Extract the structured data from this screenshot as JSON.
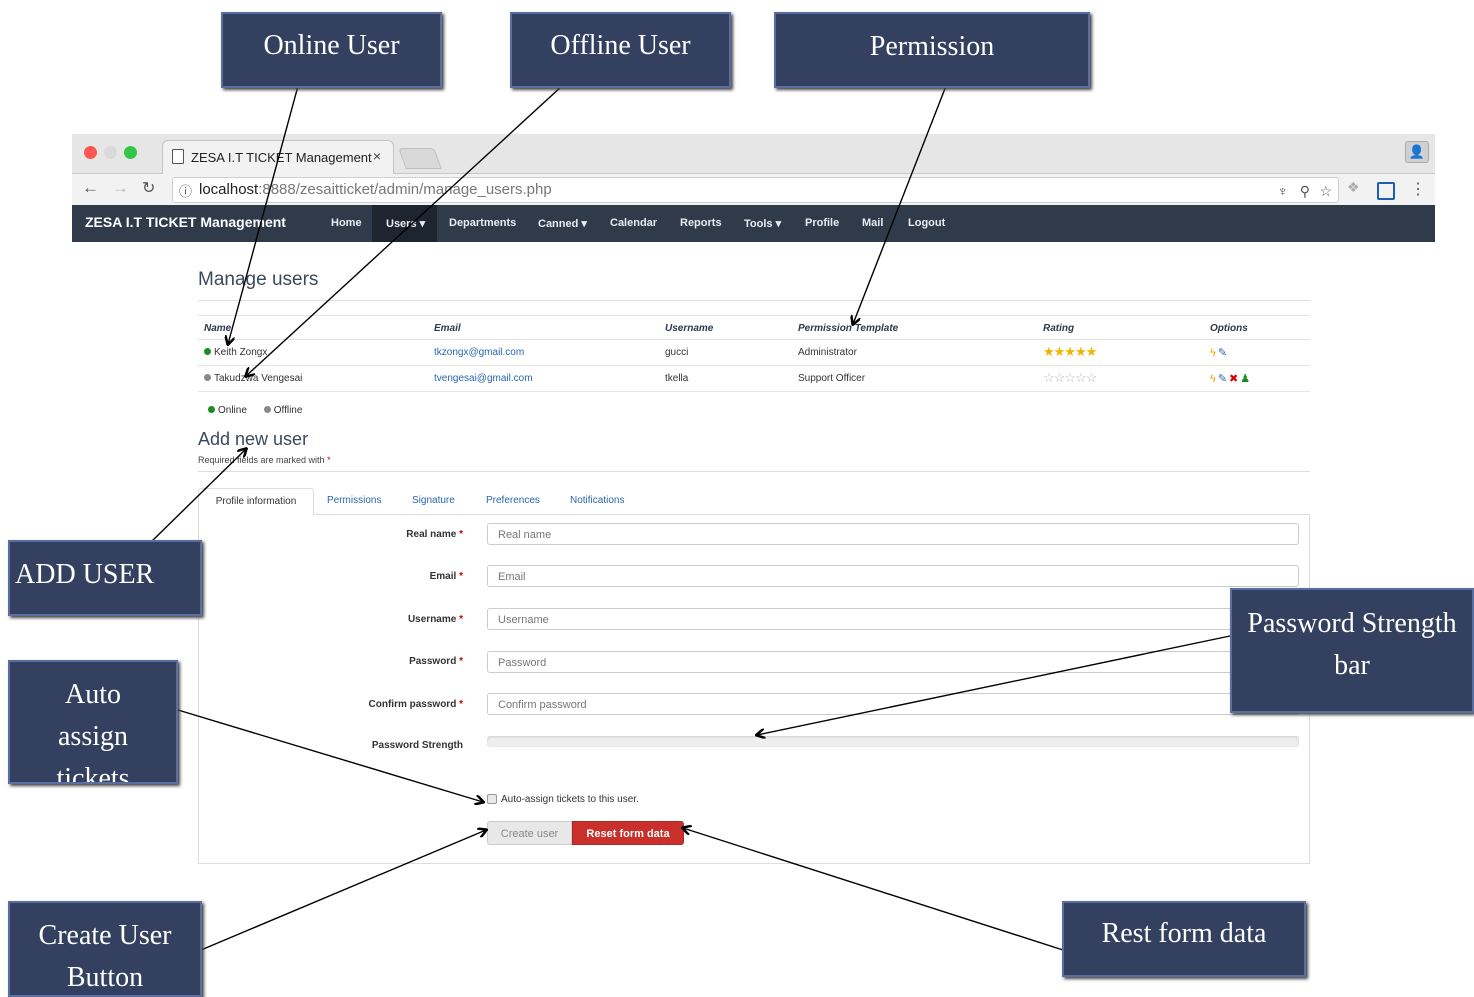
{
  "browser": {
    "tab_title": "ZESA I.T TICKET Management",
    "tab_close": "×",
    "url_host": "localhost",
    "url_path": ":8888/zesaitticket/admin/manage_users.php"
  },
  "app": {
    "brand": "ZESA I.T TICKET Management",
    "nav": {
      "home": "Home",
      "users": "Users ▾",
      "departments": "Departments",
      "canned": "Canned ▾",
      "calendar": "Calendar",
      "reports": "Reports",
      "tools": "Tools ▾",
      "profile": "Profile",
      "mail": "Mail",
      "logout": "Logout"
    }
  },
  "manage": {
    "title": "Manage users",
    "columns": {
      "name": "Name",
      "email": "Email",
      "username": "Username",
      "permission": "Permission Template",
      "rating": "Rating",
      "options": "Options"
    },
    "rows": [
      {
        "name": "Keith Zongx",
        "email": "tkzongx@gmail.com",
        "username": "gucci",
        "permission": "Administrator",
        "stars": "★★★★★"
      },
      {
        "name": "Takudzwa Vengesai",
        "email": "tvengesai@gmail.com",
        "username": "tkella",
        "permission": "Support Officer",
        "stars": "☆☆☆☆☆"
      }
    ],
    "legend_online": "Online",
    "legend_offline": "Offline"
  },
  "add": {
    "title": "Add new user",
    "required_note": "Required fields are marked with",
    "required_mark": "*",
    "tabs": {
      "profile": "Profile information",
      "permissions": "Permissions",
      "signature": "Signature",
      "preferences": "Preferences",
      "notifications": "Notifications"
    },
    "fields": {
      "realname_label": "Real name",
      "realname_placeholder": "Real name",
      "email_label": "Email",
      "email_placeholder": "Email",
      "username_label": "Username",
      "username_placeholder": "Username",
      "password_label": "Password",
      "password_placeholder": "Password",
      "confirm_label": "Confirm password",
      "confirm_placeholder": "Confirm password",
      "strength_label": "Password Strength"
    },
    "autoassign": "Auto-assign tickets to this user.",
    "create_button": "Create user",
    "reset_button": "Reset form data"
  },
  "annotations": {
    "online_user": "Online User",
    "offline_user": "Offline User",
    "permission": "Permission",
    "add_user": "ADD USER",
    "password_strength": "Password Strength bar",
    "auto_assign": "Auto assign tickets",
    "create_user": "Create User Button",
    "reset_form": "Rest form data"
  },
  "colors": {
    "nav_bg": "#2f3a4a",
    "annotation_bg": "#33405f",
    "reset_button": "#c9302c",
    "online": "#1e8c1e",
    "offline": "#888888",
    "link": "#2a66b0"
  }
}
